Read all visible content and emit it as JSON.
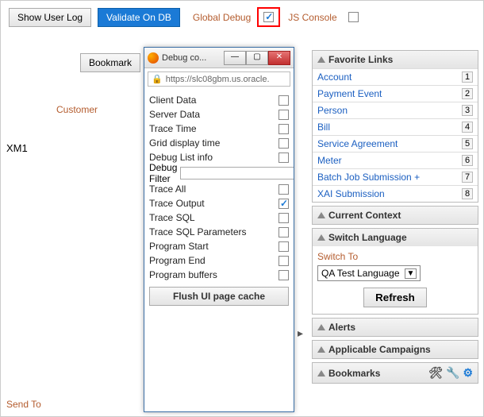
{
  "toolbar": {
    "show_user_log": "Show User Log",
    "validate_on_db": "Validate On DB",
    "global_debug": "Global Debug",
    "js_console": "JS Console"
  },
  "left": {
    "bookmark": "Bookmark",
    "customer": "Customer",
    "xm1": "XM1",
    "send_to": "Send To"
  },
  "debug_window": {
    "title": "Debug co...",
    "url": "https://slc08gbm.us.oracle.",
    "rows": [
      {
        "label": "Client Data",
        "checked": false,
        "name": "client-data"
      },
      {
        "label": "Server Data",
        "checked": false,
        "name": "server-data"
      },
      {
        "label": "Trace Time",
        "checked": false,
        "name": "trace-time"
      },
      {
        "label": "Grid display time",
        "checked": false,
        "name": "grid-display-time"
      },
      {
        "label": "Debug List info",
        "checked": false,
        "name": "debug-list-info"
      }
    ],
    "filter_label": "Debug Filter",
    "rows2": [
      {
        "label": "Trace All",
        "checked": false,
        "name": "trace-all"
      },
      {
        "label": "Trace Output",
        "checked": true,
        "name": "trace-output"
      },
      {
        "label": "Trace SQL",
        "checked": false,
        "name": "trace-sql"
      },
      {
        "label": "Trace SQL Parameters",
        "checked": false,
        "name": "trace-sql-parameters"
      },
      {
        "label": "Program Start",
        "checked": false,
        "name": "program-start"
      },
      {
        "label": "Program End",
        "checked": false,
        "name": "program-end"
      },
      {
        "label": "Program buffers",
        "checked": false,
        "name": "program-buffers"
      }
    ],
    "flush": "Flush UI page cache"
  },
  "sidebar": {
    "favorite_links": {
      "title": "Favorite Links",
      "items": [
        {
          "label": "Account",
          "shortcut": "1"
        },
        {
          "label": "Payment Event",
          "shortcut": "2"
        },
        {
          "label": "Person",
          "shortcut": "3"
        },
        {
          "label": "Bill",
          "shortcut": "4"
        },
        {
          "label": "Service Agreement",
          "shortcut": "5"
        },
        {
          "label": "Meter",
          "shortcut": "6"
        },
        {
          "label": "Batch Job Submission +",
          "shortcut": "7"
        },
        {
          "label": "XAI Submission",
          "shortcut": "8"
        }
      ]
    },
    "current_context": "Current Context",
    "switch_language": {
      "title": "Switch Language",
      "switch_to": "Switch To",
      "selected": "QA Test Language",
      "refresh": "Refresh"
    },
    "alerts": "Alerts",
    "applicable_campaigns": "Applicable Campaigns",
    "bookmarks": "Bookmarks"
  }
}
